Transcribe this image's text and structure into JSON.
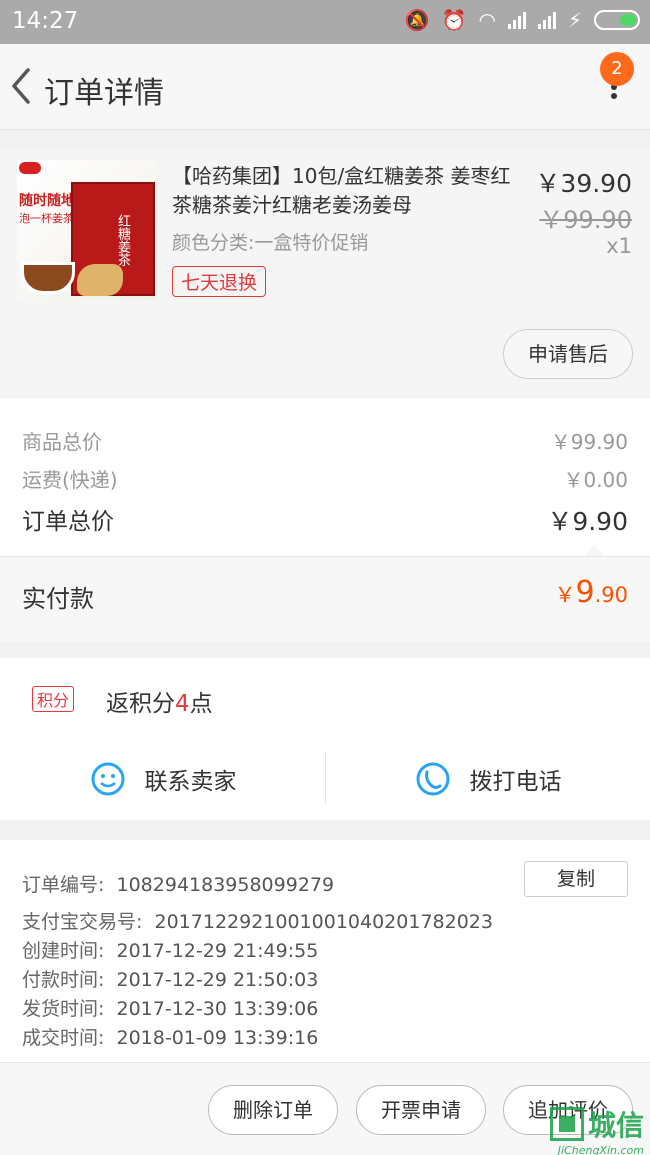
{
  "status_bar": {
    "time": "14:27"
  },
  "header": {
    "title": "订单详情",
    "badge_count": "2"
  },
  "item": {
    "name": "【哈药集团】10包/盒红糖姜茶 姜枣红茶糖茶姜汁红糖老姜汤姜母",
    "variant": "颜色分类:一盒特价促销",
    "tag": "七天退换",
    "price": "￥39.90",
    "original_price": "￥99.90",
    "quantity": "x1",
    "after_sale_button": "申请售后",
    "thumbnail_text_1": "随时随地",
    "thumbnail_text_2": "泡一杯姜茶",
    "thumbnail_box_text": "红糖姜茶"
  },
  "summary": {
    "goods_total_label": "商品总价",
    "goods_total_value": "￥99.90",
    "shipping_label": "运费(快递)",
    "shipping_value": "￥0.00",
    "order_total_label": "订单总价",
    "order_total_value": "￥9.90"
  },
  "payment": {
    "label": "实付款",
    "currency": "￥",
    "amount_main": "9",
    "amount_decimal": ".90"
  },
  "points": {
    "badge": "积分",
    "text_prefix": "返积分",
    "points": "4",
    "text_suffix": "点"
  },
  "contact": {
    "seller_label": "联系卖家",
    "call_label": "拨打电话"
  },
  "order_info": {
    "order_no_label": "订单编号:",
    "order_no": "1082941839580992​79",
    "alipay_label": "支付宝交易号:",
    "alipay_no": "2017122921001001040201782023",
    "created_label": "创建时间:",
    "created": "2017-12-29 21:49:55",
    "paid_label": "付款时间:",
    "paid": "2017-12-29 21:50:03",
    "shipped_label": "发货时间:",
    "shipped": "2017-12-30 13:39:06",
    "completed_label": "成交时间:",
    "completed": "2018-01-09 13:39:16",
    "copy_button": "复制"
  },
  "footer": {
    "delete_button": "删除订单",
    "invoice_button": "开票申请",
    "review_button": "追加评价"
  },
  "watermark": {
    "cn": "城信",
    "en": "JiChengXin.com"
  },
  "colors": {
    "accent": "#ff5000",
    "tag_red": "#e4393c",
    "badge": "#ff6a1a",
    "status_bar": "#aaaaaa"
  }
}
